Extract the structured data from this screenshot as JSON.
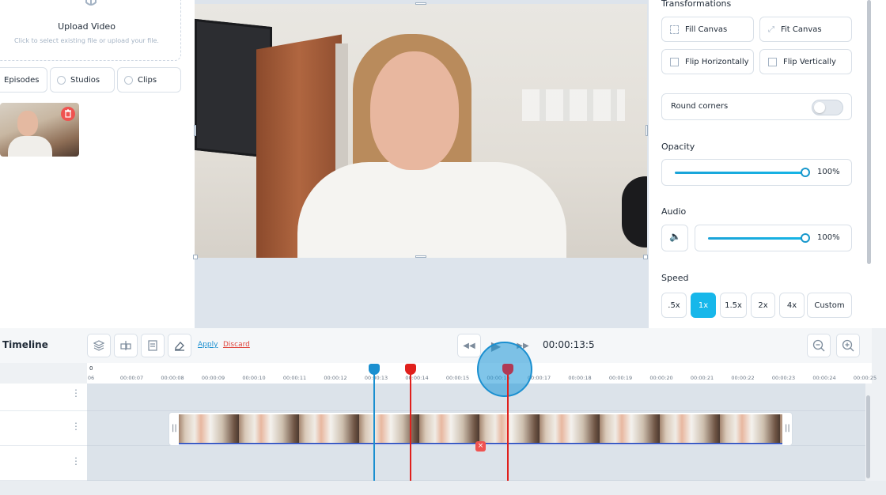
{
  "left_panel": {
    "upload_title": "Upload Video",
    "upload_subtitle": "Click to select existing file or upload your file.",
    "filters": [
      "Episodes",
      "Studios",
      "Clips"
    ]
  },
  "right_panel": {
    "transformations_title": "Transformations",
    "fill_canvas": "Fill Canvas",
    "fit_canvas": "Fit Canvas",
    "flip_horizontally": "Flip Horizontally",
    "flip_vertically": "Flip Vertically",
    "round_corners": "Round corners",
    "opacity_title": "Opacity",
    "opacity_value": "100%",
    "opacity_level": 1.0,
    "audio_title": "Audio",
    "audio_value": "100%",
    "audio_level": 1.0,
    "speed_title": "Speed",
    "speed_options": [
      ".5x",
      "1x",
      "1.5x",
      "2x",
      "4x",
      "Custom"
    ],
    "speed_selected": "1x"
  },
  "timeline": {
    "title": "Timeline",
    "apply": "Apply",
    "discard": "Discard",
    "timecode": "00:00:13:5",
    "ruler_zero": "0",
    "ticks": [
      "06",
      "00:00:07",
      "00:00:08",
      "00:00:09",
      "00:00:10",
      "00:00:11",
      "00:00:12",
      "00:00:13",
      "00:00:14",
      "00:00:15",
      "00:00:16",
      "00:00:17",
      "00:00:18",
      "00:00:19",
      "00:00:20",
      "00:00:21",
      "00:00:22",
      "00:00:23",
      "00:00:24",
      "00:00:25"
    ],
    "row_menu": "⋮",
    "clip_grip": "||",
    "remove_marker": "×"
  },
  "colors": {
    "accent": "#17b7ea",
    "playhead_blue": "#1a8fd0",
    "playhead_red": "#e0201c",
    "playhead_maroon": "#b03a55",
    "delete_red": "#ef5350"
  }
}
